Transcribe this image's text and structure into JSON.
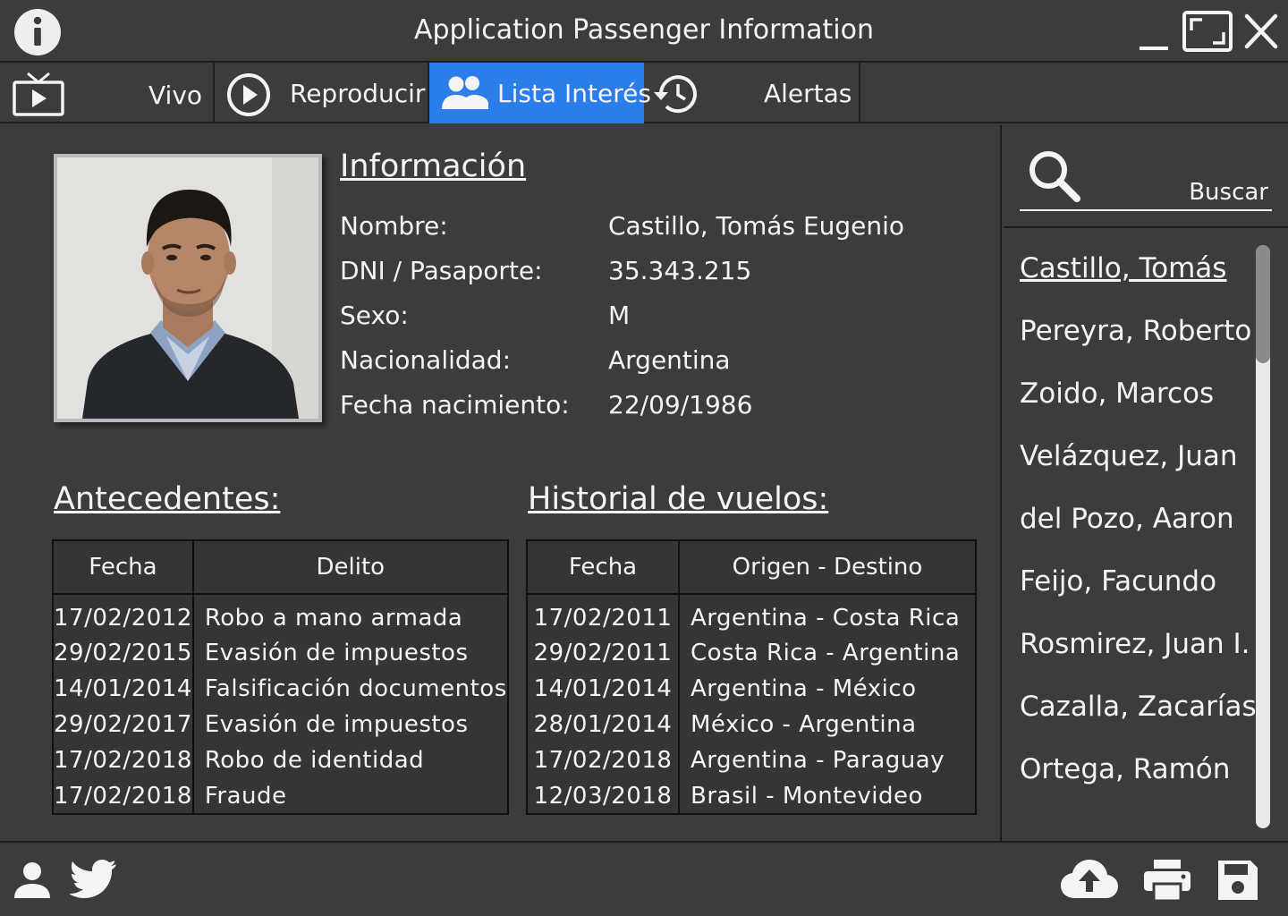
{
  "titlebar": {
    "title": "Application Passenger Information",
    "icons": [
      "info-icon",
      "minimize-icon",
      "maximize-icon",
      "close-icon"
    ]
  },
  "tabs": [
    {
      "label": "Vivo",
      "icon": "tv-icon",
      "active": false
    },
    {
      "label": "Reproducir",
      "icon": "play-circle-icon",
      "active": false
    },
    {
      "label": "Lista Interés",
      "icon": "people-icon",
      "active": true
    },
    {
      "label": "Alertas",
      "icon": "history-icon",
      "active": false
    }
  ],
  "info": {
    "title": "Información",
    "fields": [
      {
        "label": "Nombre:",
        "value": "Castillo, Tomás Eugenio"
      },
      {
        "label": "DNI / Pasaporte:",
        "value": "35.343.215"
      },
      {
        "label": "Sexo:",
        "value": "M"
      },
      {
        "label": "Nacionalidad:",
        "value": "Argentina"
      },
      {
        "label": "Fecha nacimiento:",
        "value": "22/09/1986"
      }
    ]
  },
  "antecedentes": {
    "title": "Antecedentes:",
    "headers": [
      "Fecha",
      "Delito"
    ],
    "rows": [
      [
        "17/02/2012",
        "Robo a mano armada"
      ],
      [
        "29/02/2015",
        "Evasión de impuestos"
      ],
      [
        "14/01/2014",
        "Falsificación documentos"
      ],
      [
        "29/02/2017",
        "Evasión de impuestos"
      ],
      [
        "17/02/2018",
        "Robo de identidad"
      ],
      [
        "17/02/2018",
        "Fraude"
      ]
    ]
  },
  "vuelos": {
    "title": "Historial de vuelos:",
    "headers": [
      "Fecha",
      "Origen - Destino"
    ],
    "rows": [
      [
        "17/02/2011",
        "Argentina - Costa Rica"
      ],
      [
        "29/02/2011",
        "Costa Rica - Argentina"
      ],
      [
        "14/01/2014",
        "Argentina - México"
      ],
      [
        "28/01/2014",
        "México - Argentina"
      ],
      [
        "17/02/2018",
        "Argentina - Paraguay"
      ],
      [
        "12/03/2018",
        "Brasil - Montevideo"
      ]
    ]
  },
  "search": {
    "label": "Buscar",
    "icon": "search-icon"
  },
  "people_list": [
    {
      "name": "Castillo, Tomás",
      "selected": true
    },
    {
      "name": "Pereyra, Roberto",
      "selected": false
    },
    {
      "name": "Zoido, Marcos",
      "selected": false
    },
    {
      "name": "Velázquez, Juan",
      "selected": false
    },
    {
      "name": "del Pozo, Aaron",
      "selected": false
    },
    {
      "name": "Feijo, Facundo",
      "selected": false
    },
    {
      "name": "Rosmirez, Juan I.",
      "selected": false
    },
    {
      "name": "Cazalla, Zacarías",
      "selected": false
    },
    {
      "name": "Ortega, Ramón",
      "selected": false
    }
  ],
  "bottombar": {
    "icons": [
      "user-icon",
      "twitter-icon",
      "cloud-upload-icon",
      "printer-icon",
      "save-icon"
    ]
  },
  "colors": {
    "background": "#3c3c3c",
    "accent": "#2b7de9",
    "text": "#f4f4f4",
    "divider": "#1e1e1e"
  }
}
